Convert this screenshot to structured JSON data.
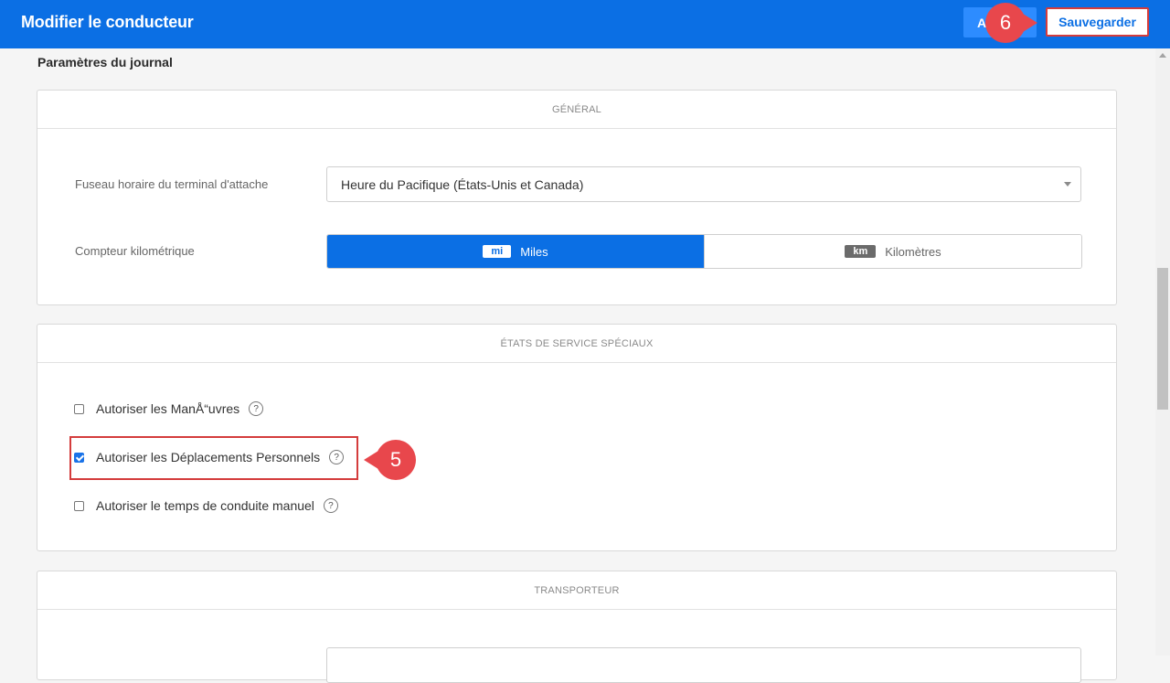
{
  "header": {
    "title": "Modifier le conducteur",
    "cancel_label": "A",
    "save_label": "Sauvegarder"
  },
  "callouts": {
    "save_step": "6",
    "personal_step": "5"
  },
  "page": {
    "section_title": "Paramètres du journal"
  },
  "general": {
    "header": "GÉNÉRAL",
    "timezone_label": "Fuseau horaire du terminal d'attache",
    "timezone_value": "Heure du Pacifique (États-Unis et Canada)",
    "odometer_label": "Compteur kilométrique",
    "odometer_options": [
      {
        "badge": "mi",
        "label": "Miles",
        "selected": true
      },
      {
        "badge": "km",
        "label": "Kilomètres",
        "selected": false
      }
    ]
  },
  "special": {
    "header": "ÉTATS DE SERVICE SPÉCIAUX",
    "options": [
      {
        "label": "Autoriser les ManÅ“uvres",
        "checked": false
      },
      {
        "label": "Autoriser les Déplacements Personnels",
        "checked": true
      },
      {
        "label": "Autoriser le temps de conduite manuel",
        "checked": false
      }
    ],
    "help_glyph": "?"
  },
  "carrier": {
    "header": "TRANSPORTEUR"
  },
  "colors": {
    "header_bg": "#0b6fe4",
    "accent": "#0b6fe4",
    "callout": "#e8474c",
    "highlight": "#d43c3c"
  }
}
